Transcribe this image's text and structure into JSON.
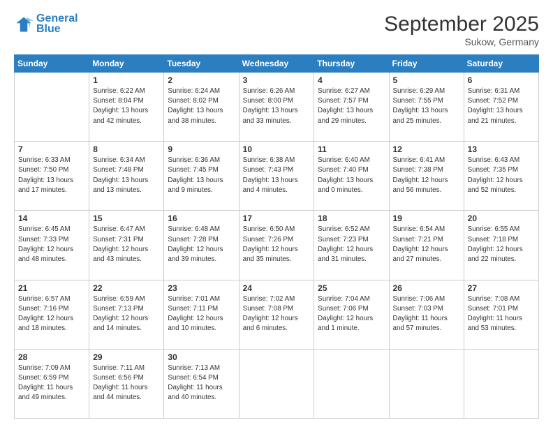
{
  "header": {
    "logo_line1": "General",
    "logo_line2": "Blue",
    "month": "September 2025",
    "location": "Sukow, Germany"
  },
  "weekdays": [
    "Sunday",
    "Monday",
    "Tuesday",
    "Wednesday",
    "Thursday",
    "Friday",
    "Saturday"
  ],
  "weeks": [
    [
      {
        "day": "",
        "info": ""
      },
      {
        "day": "1",
        "info": "Sunrise: 6:22 AM\nSunset: 8:04 PM\nDaylight: 13 hours\nand 42 minutes."
      },
      {
        "day": "2",
        "info": "Sunrise: 6:24 AM\nSunset: 8:02 PM\nDaylight: 13 hours\nand 38 minutes."
      },
      {
        "day": "3",
        "info": "Sunrise: 6:26 AM\nSunset: 8:00 PM\nDaylight: 13 hours\nand 33 minutes."
      },
      {
        "day": "4",
        "info": "Sunrise: 6:27 AM\nSunset: 7:57 PM\nDaylight: 13 hours\nand 29 minutes."
      },
      {
        "day": "5",
        "info": "Sunrise: 6:29 AM\nSunset: 7:55 PM\nDaylight: 13 hours\nand 25 minutes."
      },
      {
        "day": "6",
        "info": "Sunrise: 6:31 AM\nSunset: 7:52 PM\nDaylight: 13 hours\nand 21 minutes."
      }
    ],
    [
      {
        "day": "7",
        "info": "Sunrise: 6:33 AM\nSunset: 7:50 PM\nDaylight: 13 hours\nand 17 minutes."
      },
      {
        "day": "8",
        "info": "Sunrise: 6:34 AM\nSunset: 7:48 PM\nDaylight: 13 hours\nand 13 minutes."
      },
      {
        "day": "9",
        "info": "Sunrise: 6:36 AM\nSunset: 7:45 PM\nDaylight: 13 hours\nand 9 minutes."
      },
      {
        "day": "10",
        "info": "Sunrise: 6:38 AM\nSunset: 7:43 PM\nDaylight: 13 hours\nand 4 minutes."
      },
      {
        "day": "11",
        "info": "Sunrise: 6:40 AM\nSunset: 7:40 PM\nDaylight: 13 hours\nand 0 minutes."
      },
      {
        "day": "12",
        "info": "Sunrise: 6:41 AM\nSunset: 7:38 PM\nDaylight: 12 hours\nand 56 minutes."
      },
      {
        "day": "13",
        "info": "Sunrise: 6:43 AM\nSunset: 7:35 PM\nDaylight: 12 hours\nand 52 minutes."
      }
    ],
    [
      {
        "day": "14",
        "info": "Sunrise: 6:45 AM\nSunset: 7:33 PM\nDaylight: 12 hours\nand 48 minutes."
      },
      {
        "day": "15",
        "info": "Sunrise: 6:47 AM\nSunset: 7:31 PM\nDaylight: 12 hours\nand 43 minutes."
      },
      {
        "day": "16",
        "info": "Sunrise: 6:48 AM\nSunset: 7:28 PM\nDaylight: 12 hours\nand 39 minutes."
      },
      {
        "day": "17",
        "info": "Sunrise: 6:50 AM\nSunset: 7:26 PM\nDaylight: 12 hours\nand 35 minutes."
      },
      {
        "day": "18",
        "info": "Sunrise: 6:52 AM\nSunset: 7:23 PM\nDaylight: 12 hours\nand 31 minutes."
      },
      {
        "day": "19",
        "info": "Sunrise: 6:54 AM\nSunset: 7:21 PM\nDaylight: 12 hours\nand 27 minutes."
      },
      {
        "day": "20",
        "info": "Sunrise: 6:55 AM\nSunset: 7:18 PM\nDaylight: 12 hours\nand 22 minutes."
      }
    ],
    [
      {
        "day": "21",
        "info": "Sunrise: 6:57 AM\nSunset: 7:16 PM\nDaylight: 12 hours\nand 18 minutes."
      },
      {
        "day": "22",
        "info": "Sunrise: 6:59 AM\nSunset: 7:13 PM\nDaylight: 12 hours\nand 14 minutes."
      },
      {
        "day": "23",
        "info": "Sunrise: 7:01 AM\nSunset: 7:11 PM\nDaylight: 12 hours\nand 10 minutes."
      },
      {
        "day": "24",
        "info": "Sunrise: 7:02 AM\nSunset: 7:08 PM\nDaylight: 12 hours\nand 6 minutes."
      },
      {
        "day": "25",
        "info": "Sunrise: 7:04 AM\nSunset: 7:06 PM\nDaylight: 12 hours\nand 1 minute."
      },
      {
        "day": "26",
        "info": "Sunrise: 7:06 AM\nSunset: 7:03 PM\nDaylight: 11 hours\nand 57 minutes."
      },
      {
        "day": "27",
        "info": "Sunrise: 7:08 AM\nSunset: 7:01 PM\nDaylight: 11 hours\nand 53 minutes."
      }
    ],
    [
      {
        "day": "28",
        "info": "Sunrise: 7:09 AM\nSunset: 6:59 PM\nDaylight: 11 hours\nand 49 minutes."
      },
      {
        "day": "29",
        "info": "Sunrise: 7:11 AM\nSunset: 6:56 PM\nDaylight: 11 hours\nand 44 minutes."
      },
      {
        "day": "30",
        "info": "Sunrise: 7:13 AM\nSunset: 6:54 PM\nDaylight: 11 hours\nand 40 minutes."
      },
      {
        "day": "",
        "info": ""
      },
      {
        "day": "",
        "info": ""
      },
      {
        "day": "",
        "info": ""
      },
      {
        "day": "",
        "info": ""
      }
    ]
  ]
}
